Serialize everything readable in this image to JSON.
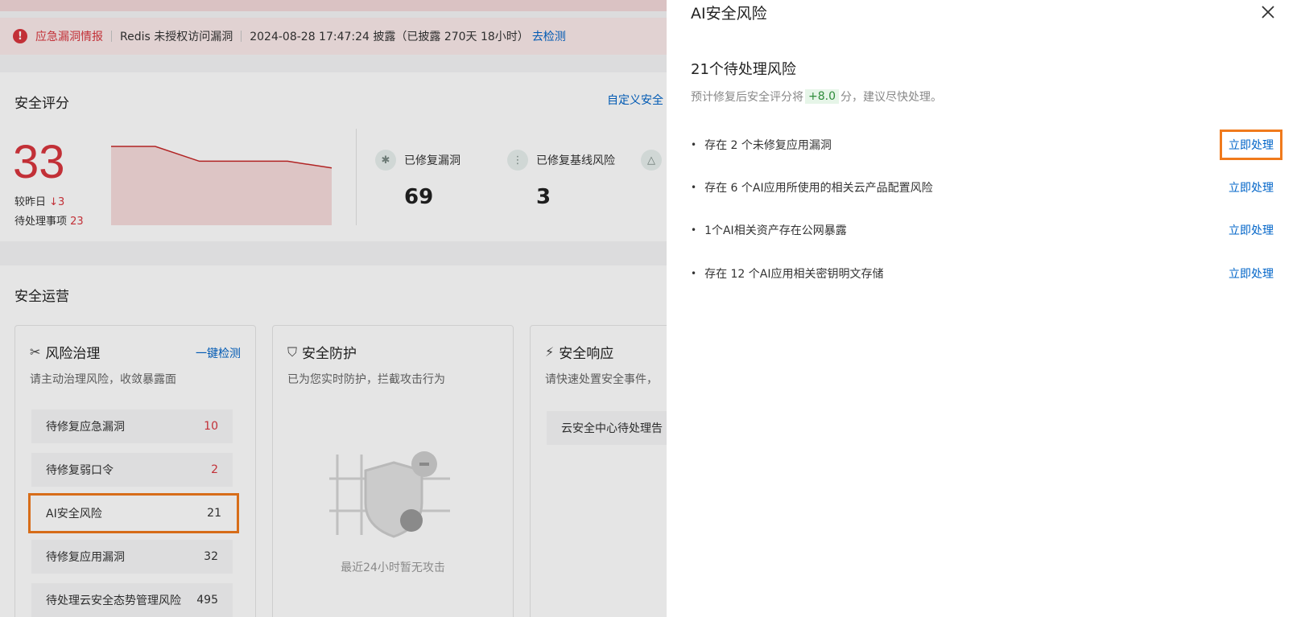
{
  "alert": {
    "tag": "应急漏洞情报",
    "text": "Redis 未授权访问漏洞",
    "time": "2024-08-28 17:47:24 披露（已披露 270天 18小时）",
    "link": "去检测"
  },
  "score": {
    "title": "安全评分",
    "custom_link": "自定义安全",
    "value": "33",
    "compare_label": "较昨日",
    "compare_value": "↓3",
    "pending_label": "待处理事项",
    "pending_value": "23",
    "trend": [
      1,
      1,
      0.78,
      0.78,
      0.78,
      0.68
    ]
  },
  "stats": [
    {
      "label": "已修复漏洞",
      "value": "69",
      "icon": "bug-icon"
    },
    {
      "label": "已修复基线风险",
      "value": "3",
      "icon": "waveform-icon"
    }
  ],
  "ops": {
    "title": "安全运营",
    "risk_panel": {
      "title": "风险治理",
      "link": "一键检测",
      "subtitle": "请主动治理风险，收敛暴露面",
      "items": [
        {
          "label": "待修复应急漏洞",
          "count": "10"
        },
        {
          "label": "待修复弱口令",
          "count": "2"
        },
        {
          "label": "AI安全风险",
          "count": "21"
        },
        {
          "label": "待修复应用漏洞",
          "count": "32"
        },
        {
          "label": "待处理云安全态势管理风险",
          "count": "495"
        }
      ]
    },
    "protect_panel": {
      "title": "安全防护",
      "subtitle": "已为您实时防护，拦截攻击行为",
      "empty_text": "最近24小时暂无攻击"
    },
    "response_panel": {
      "title": "安全响应",
      "subtitle": "请快速处置安全事件，",
      "item": "云安全中心待处理告"
    }
  },
  "drawer": {
    "title": "AI安全风险",
    "pending_title": "21个待处理风险",
    "desc_before": "预计修复后安全评分将",
    "desc_delta": "+8.0",
    "desc_after": "分，建议尽快处理。",
    "action_label": "立即处理",
    "risks": [
      {
        "text": "存在 2 个未修复应用漏洞"
      },
      {
        "text": "存在 6 个AI应用所使用的相关云产品配置风险"
      },
      {
        "text": " 1个AI相关资产存在公网暴露"
      },
      {
        "text": "存在 12 个AI应用相关密钥明文存储"
      }
    ]
  }
}
